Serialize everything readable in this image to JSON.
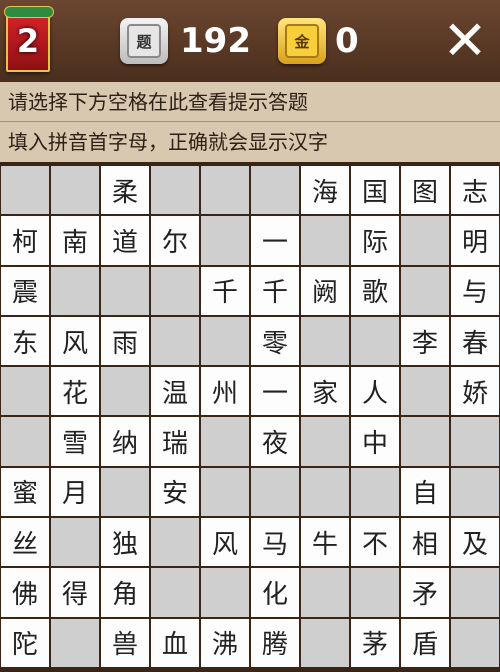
{
  "header": {
    "level": "2",
    "hint_icon_char": "题",
    "hint_count": "192",
    "coin_icon_char": "金",
    "coin_count": "0",
    "close_glyph": "✕"
  },
  "instructions": [
    "请选择下方空格在此查看提示答题",
    "填入拼音首字母，正确就会显示汉字"
  ],
  "grid": [
    [
      "",
      "",
      "柔",
      "",
      "",
      "",
      "海",
      "国",
      "图",
      "志"
    ],
    [
      "柯",
      "南",
      "道",
      "尔",
      "",
      "一",
      "",
      "际",
      "",
      "明"
    ],
    [
      "震",
      "",
      "",
      "",
      "千",
      "千",
      "阙",
      "歌",
      "",
      "与"
    ],
    [
      "东",
      "风",
      "雨",
      "",
      "",
      "零",
      "",
      "",
      "李",
      "春"
    ],
    [
      "",
      "花",
      "",
      "温",
      "州",
      "一",
      "家",
      "人",
      "",
      "娇"
    ],
    [
      "",
      "雪",
      "纳",
      "瑞",
      "",
      "夜",
      "",
      "中",
      "",
      ""
    ],
    [
      "蜜",
      "月",
      "",
      "安",
      "",
      "",
      "",
      "",
      "自",
      ""
    ],
    [
      "丝",
      "",
      "独",
      "",
      "风",
      "马",
      "牛",
      "不",
      "相",
      "及"
    ],
    [
      "佛",
      "得",
      "角",
      "",
      "",
      "化",
      "",
      "",
      "矛",
      ""
    ],
    [
      "陀",
      "",
      "兽",
      "血",
      "沸",
      "腾",
      "",
      "茅",
      "盾",
      ""
    ]
  ],
  "colors": {
    "empty_cell": "#cfcfcf",
    "filled_cell": "#fdfdfd",
    "grid_line": "#3a2416",
    "instruction_bg": "#d9c8b0"
  }
}
